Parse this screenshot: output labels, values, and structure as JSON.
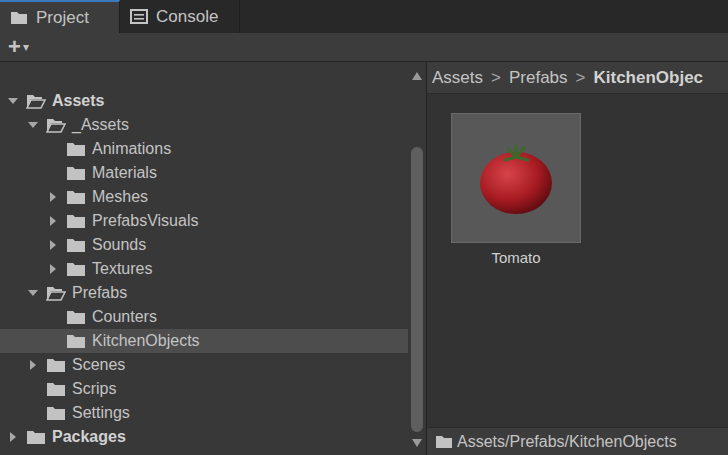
{
  "tabs": [
    {
      "label": "Project",
      "icon": "folder",
      "selected": true
    },
    {
      "label": "Console",
      "icon": "console",
      "selected": false
    }
  ],
  "toolbar": {
    "add_button": "+",
    "add_menu": "▾"
  },
  "tree": [
    {
      "name": "Assets",
      "depth": 0,
      "kind": "root",
      "expandable": true,
      "expanded": true,
      "selected": false
    },
    {
      "name": "_Assets",
      "depth": 1,
      "kind": "folder",
      "expandable": true,
      "expanded": true,
      "selected": false
    },
    {
      "name": "Animations",
      "depth": 2,
      "kind": "folder",
      "expandable": false,
      "expanded": false,
      "selected": false
    },
    {
      "name": "Materials",
      "depth": 2,
      "kind": "folder",
      "expandable": false,
      "expanded": false,
      "selected": false
    },
    {
      "name": "Meshes",
      "depth": 2,
      "kind": "folder",
      "expandable": true,
      "expanded": false,
      "selected": false
    },
    {
      "name": "PrefabsVisuals",
      "depth": 2,
      "kind": "folder",
      "expandable": true,
      "expanded": false,
      "selected": false
    },
    {
      "name": "Sounds",
      "depth": 2,
      "kind": "folder",
      "expandable": true,
      "expanded": false,
      "selected": false
    },
    {
      "name": "Textures",
      "depth": 2,
      "kind": "folder",
      "expandable": true,
      "expanded": false,
      "selected": false
    },
    {
      "name": "Prefabs",
      "depth": 1,
      "kind": "folder",
      "expandable": true,
      "expanded": true,
      "selected": false
    },
    {
      "name": "Counters",
      "depth": 2,
      "kind": "folder",
      "expandable": false,
      "expanded": false,
      "selected": false
    },
    {
      "name": "KitchenObjects",
      "depth": 2,
      "kind": "folder",
      "expandable": false,
      "expanded": false,
      "selected": true
    },
    {
      "name": "Scenes",
      "depth": 1,
      "kind": "folder",
      "expandable": true,
      "expanded": false,
      "selected": false
    },
    {
      "name": "Scrips",
      "depth": 1,
      "kind": "folder",
      "expandable": false,
      "expanded": false,
      "selected": false
    },
    {
      "name": "Settings",
      "depth": 1,
      "kind": "folder",
      "expandable": false,
      "expanded": false,
      "selected": false
    },
    {
      "name": "Packages",
      "depth": 0,
      "kind": "root",
      "expandable": true,
      "expanded": false,
      "selected": false
    }
  ],
  "scrollbar": {
    "offset": 0.18,
    "level": 0.81
  },
  "breadcrumb": {
    "items": [
      "Assets",
      "Prefabs",
      "KitchenObjec"
    ],
    "separator": ">"
  },
  "assets": [
    {
      "name": "Tomato",
      "selected": false
    }
  ],
  "path_bar": {
    "path": "Assets/Prefabs/KitchenObjects"
  }
}
